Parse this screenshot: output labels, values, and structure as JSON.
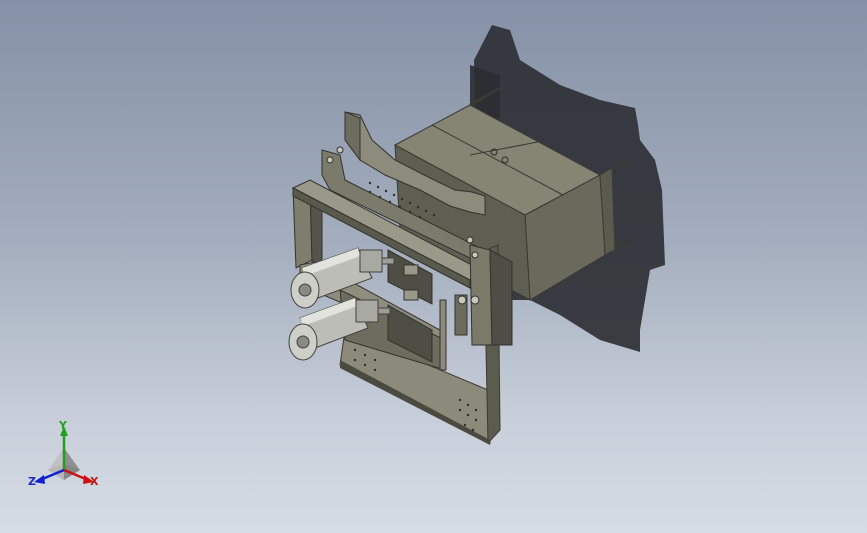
{
  "viewport": {
    "background_top": "#8591a6",
    "background_bottom": "#d6dce5"
  },
  "model": {
    "description_icon": "3d-assembly-icon",
    "body_color": "#6e6d60",
    "body_light": "#8c8a7a",
    "body_dark": "#4a4a40",
    "shadow_color": "#2a2c30",
    "cylinder_color": "#b9b9b4",
    "plate_color": "#8a8878"
  },
  "triad": {
    "x_label": "X",
    "y_label": "Y",
    "z_label": "Z",
    "x_color": "#d01010",
    "y_color": "#20a020",
    "z_color": "#1020d0"
  }
}
